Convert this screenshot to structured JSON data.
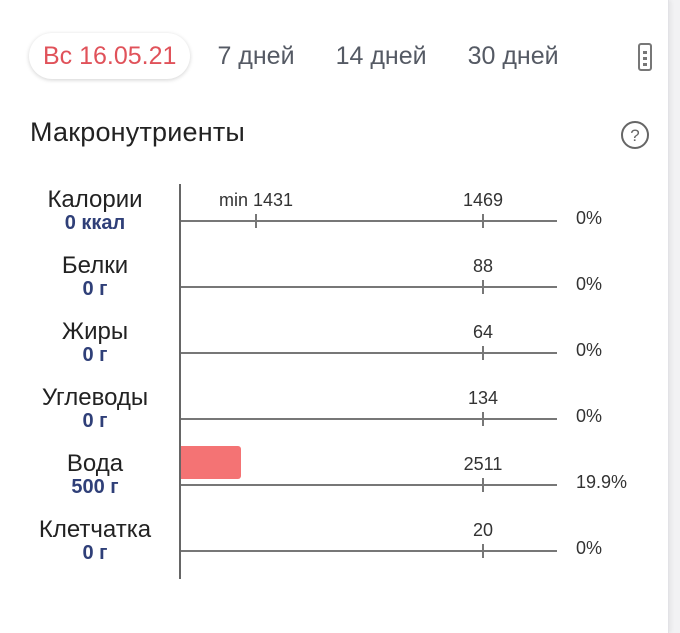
{
  "tabs": [
    {
      "label": "Вс 16.05.21",
      "active": true
    },
    {
      "label": "7 дней",
      "active": false
    },
    {
      "label": "14 дней",
      "active": false
    },
    {
      "label": "30 дней",
      "active": false
    }
  ],
  "section": {
    "title": "Макронутриенты"
  },
  "colors": {
    "accent": "#e0525a",
    "bar": "#f47374",
    "amount": "#2f3f78"
  },
  "nutrients": [
    {
      "name": "Калории",
      "amount": "0 ккал",
      "min_label": "min 1431",
      "min_value": 1431,
      "target_label": "1469",
      "target_value": 1469,
      "percent_label": "0%",
      "percent": 0
    },
    {
      "name": "Белки",
      "amount": "0 г",
      "target_label": "88",
      "target_value": 88,
      "percent_label": "0%",
      "percent": 0
    },
    {
      "name": "Жиры",
      "amount": "0 г",
      "target_label": "64",
      "target_value": 64,
      "percent_label": "0%",
      "percent": 0
    },
    {
      "name": "Углеводы",
      "amount": "0 г",
      "target_label": "134",
      "target_value": 134,
      "percent_label": "0%",
      "percent": 0
    },
    {
      "name": "Вода",
      "amount": "500 г",
      "target_label": "2511",
      "target_value": 2511,
      "percent_label": "19.9%",
      "percent": 19.9
    },
    {
      "name": "Клетчатка",
      "amount": "0 г",
      "target_label": "20",
      "target_value": 20,
      "percent_label": "0%",
      "percent": 0
    }
  ]
}
